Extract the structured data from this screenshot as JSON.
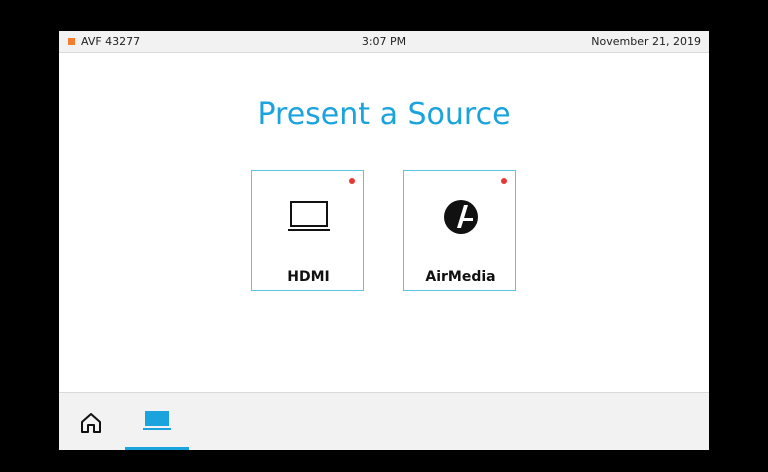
{
  "status_bar": {
    "room_name": "AVF 43277",
    "time": "3:07 PM",
    "date": "November 21, 2019",
    "indicator_color": "#f47d30"
  },
  "main": {
    "title": "Present a Source",
    "title_color": "#1aa3dc",
    "sources": [
      {
        "label": "HDMI",
        "icon": "laptop-icon",
        "status_dot_color": "#e53935"
      },
      {
        "label": "AirMedia",
        "icon": "airmedia-icon",
        "status_dot_color": "#e53935"
      }
    ]
  },
  "bottom_nav": {
    "items": [
      {
        "icon": "home-icon",
        "selected": false
      },
      {
        "icon": "laptop-icon",
        "selected": true
      }
    ],
    "selected_color": "#1aa3dc"
  }
}
